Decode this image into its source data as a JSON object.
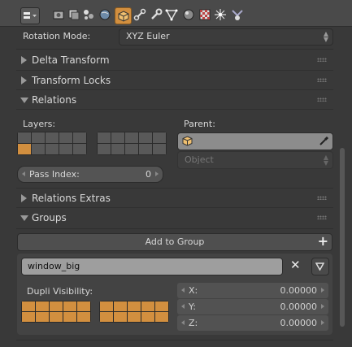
{
  "toolbar": {
    "icons": [
      "editor-type-icon",
      "render-icon",
      "render-layers-icon",
      "scene-icon",
      "world-icon",
      "object-icon",
      "constraints-icon",
      "modifiers-icon",
      "data-icon",
      "material-icon",
      "texture-icon",
      "particles-icon",
      "physics-icon"
    ]
  },
  "rotation_mode": {
    "label": "Rotation Mode:",
    "value": "XYZ Euler"
  },
  "panels": {
    "delta_transform": "Delta Transform",
    "transform_locks": "Transform Locks",
    "relations": "Relations",
    "relations_extras": "Relations Extras",
    "groups": "Groups"
  },
  "relations": {
    "layers_label": "Layers:",
    "parent_label": "Parent:",
    "parent_type_placeholder": "Object",
    "pass_index_label": "Pass Index:",
    "pass_index_value": "0"
  },
  "groups": {
    "add_to_group": "Add to Group",
    "group_name": "window_big",
    "dupli_visibility_label": "Dupli Visibility:",
    "dupli_offset": [
      {
        "axis": "X:",
        "value": "0.00000"
      },
      {
        "axis": "Y:",
        "value": "0.00000"
      },
      {
        "axis": "Z:",
        "value": "0.00000"
      }
    ]
  },
  "colors": {
    "accent": "#d28f3f",
    "background": "#393939",
    "panel": "#434343"
  }
}
